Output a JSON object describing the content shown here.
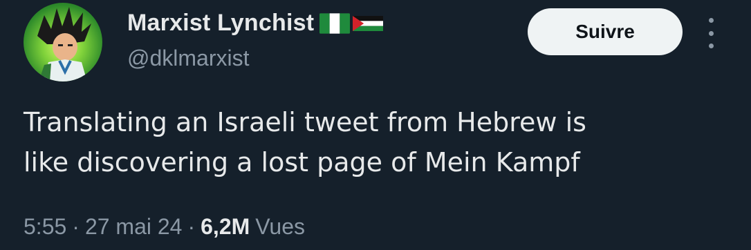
{
  "author": {
    "display_name": "Marxist Lynchist",
    "handle": "@dklmarxist",
    "flags": [
      "nigeria-flag-icon",
      "palestine-flag-icon"
    ],
    "avatar": "anime-character-avatar"
  },
  "actions": {
    "follow_label": "Suivre",
    "more_icon": "more-vertical-icon"
  },
  "tweet": {
    "text": "Translating an Israeli tweet from Hebrew is\nlike discovering a lost page of Mein Kampf"
  },
  "meta": {
    "time": "5:55",
    "separator": "·",
    "date": "27 mai 24",
    "views_count": "6,2M",
    "views_label": "Vues"
  },
  "colors": {
    "background": "#15202b",
    "text_primary": "#e7e9ea",
    "text_secondary": "#8b98a5",
    "follow_button_bg": "#eff3f4"
  }
}
